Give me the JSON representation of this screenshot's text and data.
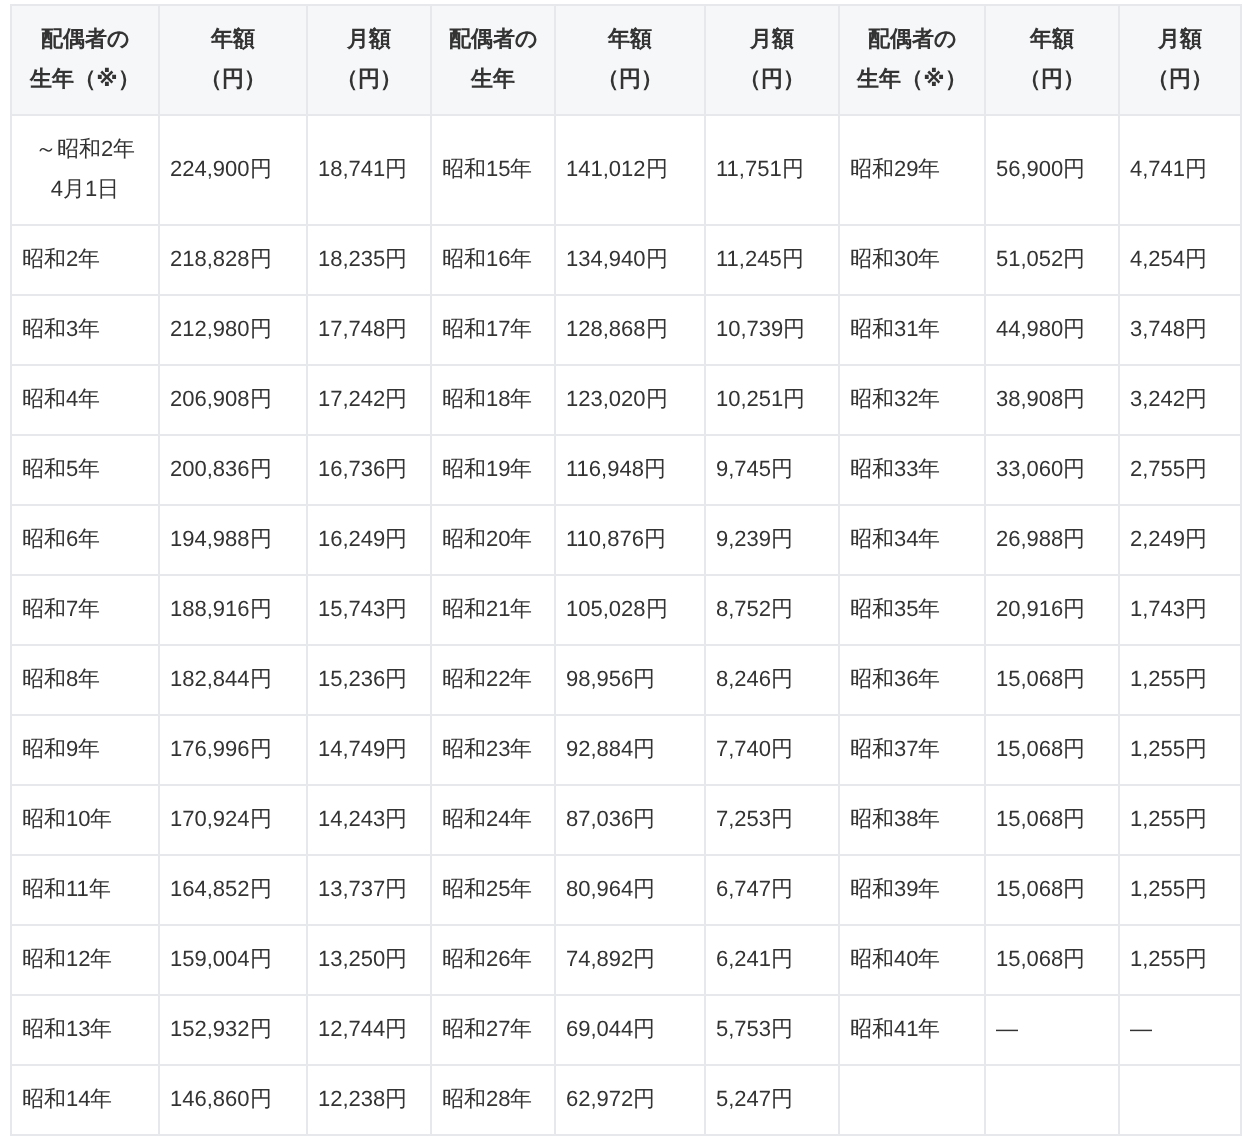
{
  "table": {
    "columns": [
      {
        "lines": [
          "配偶者の",
          "生年（※）"
        ]
      },
      {
        "lines": [
          "年額",
          "（円）"
        ]
      },
      {
        "lines": [
          "月額",
          "（円）"
        ]
      },
      {
        "lines": [
          "配偶者の",
          "生年"
        ]
      },
      {
        "lines": [
          "年額",
          "（円）"
        ]
      },
      {
        "lines": [
          "月額",
          "（円）"
        ]
      },
      {
        "lines": [
          "配偶者の",
          "生年（※）"
        ]
      },
      {
        "lines": [
          "年額",
          "（円）"
        ]
      },
      {
        "lines": [
          "月額",
          "（円）"
        ]
      }
    ],
    "rows": [
      [
        {
          "lines": [
            "～昭和2年",
            "4月1日"
          ]
        },
        "224,900円",
        "18,741円",
        "昭和15年",
        "141,012円",
        "11,751円",
        "昭和29年",
        "56,900円",
        "4,741円"
      ],
      [
        "昭和2年",
        "218,828円",
        "18,235円",
        "昭和16年",
        "134,940円",
        "11,245円",
        "昭和30年",
        "51,052円",
        "4,254円"
      ],
      [
        "昭和3年",
        "212,980円",
        "17,748円",
        "昭和17年",
        "128,868円",
        "10,739円",
        "昭和31年",
        "44,980円",
        "3,748円"
      ],
      [
        "昭和4年",
        "206,908円",
        "17,242円",
        "昭和18年",
        "123,020円",
        "10,251円",
        "昭和32年",
        "38,908円",
        "3,242円"
      ],
      [
        "昭和5年",
        "200,836円",
        "16,736円",
        "昭和19年",
        "116,948円",
        "9,745円",
        "昭和33年",
        "33,060円",
        "2,755円"
      ],
      [
        "昭和6年",
        "194,988円",
        "16,249円",
        "昭和20年",
        "110,876円",
        "9,239円",
        "昭和34年",
        "26,988円",
        "2,249円"
      ],
      [
        "昭和7年",
        "188,916円",
        "15,743円",
        "昭和21年",
        "105,028円",
        "8,752円",
        "昭和35年",
        "20,916円",
        "1,743円"
      ],
      [
        "昭和8年",
        "182,844円",
        "15,236円",
        "昭和22年",
        "98,956円",
        "8,246円",
        "昭和36年",
        "15,068円",
        "1,255円"
      ],
      [
        "昭和9年",
        "176,996円",
        "14,749円",
        "昭和23年",
        "92,884円",
        "7,740円",
        "昭和37年",
        "15,068円",
        "1,255円"
      ],
      [
        "昭和10年",
        "170,924円",
        "14,243円",
        "昭和24年",
        "87,036円",
        "7,253円",
        "昭和38年",
        "15,068円",
        "1,255円"
      ],
      [
        "昭和11年",
        "164,852円",
        "13,737円",
        "昭和25年",
        "80,964円",
        "6,747円",
        "昭和39年",
        "15,068円",
        "1,255円"
      ],
      [
        "昭和12年",
        "159,004円",
        "13,250円",
        "昭和26年",
        "74,892円",
        "6,241円",
        "昭和40年",
        "15,068円",
        "1,255円"
      ],
      [
        "昭和13年",
        "152,932円",
        "12,744円",
        "昭和27年",
        "69,044円",
        "5,753円",
        "昭和41年",
        "—",
        "—"
      ],
      [
        "昭和14年",
        "146,860円",
        "12,238円",
        "昭和28年",
        "62,972円",
        "5,247円"
      ]
    ]
  }
}
